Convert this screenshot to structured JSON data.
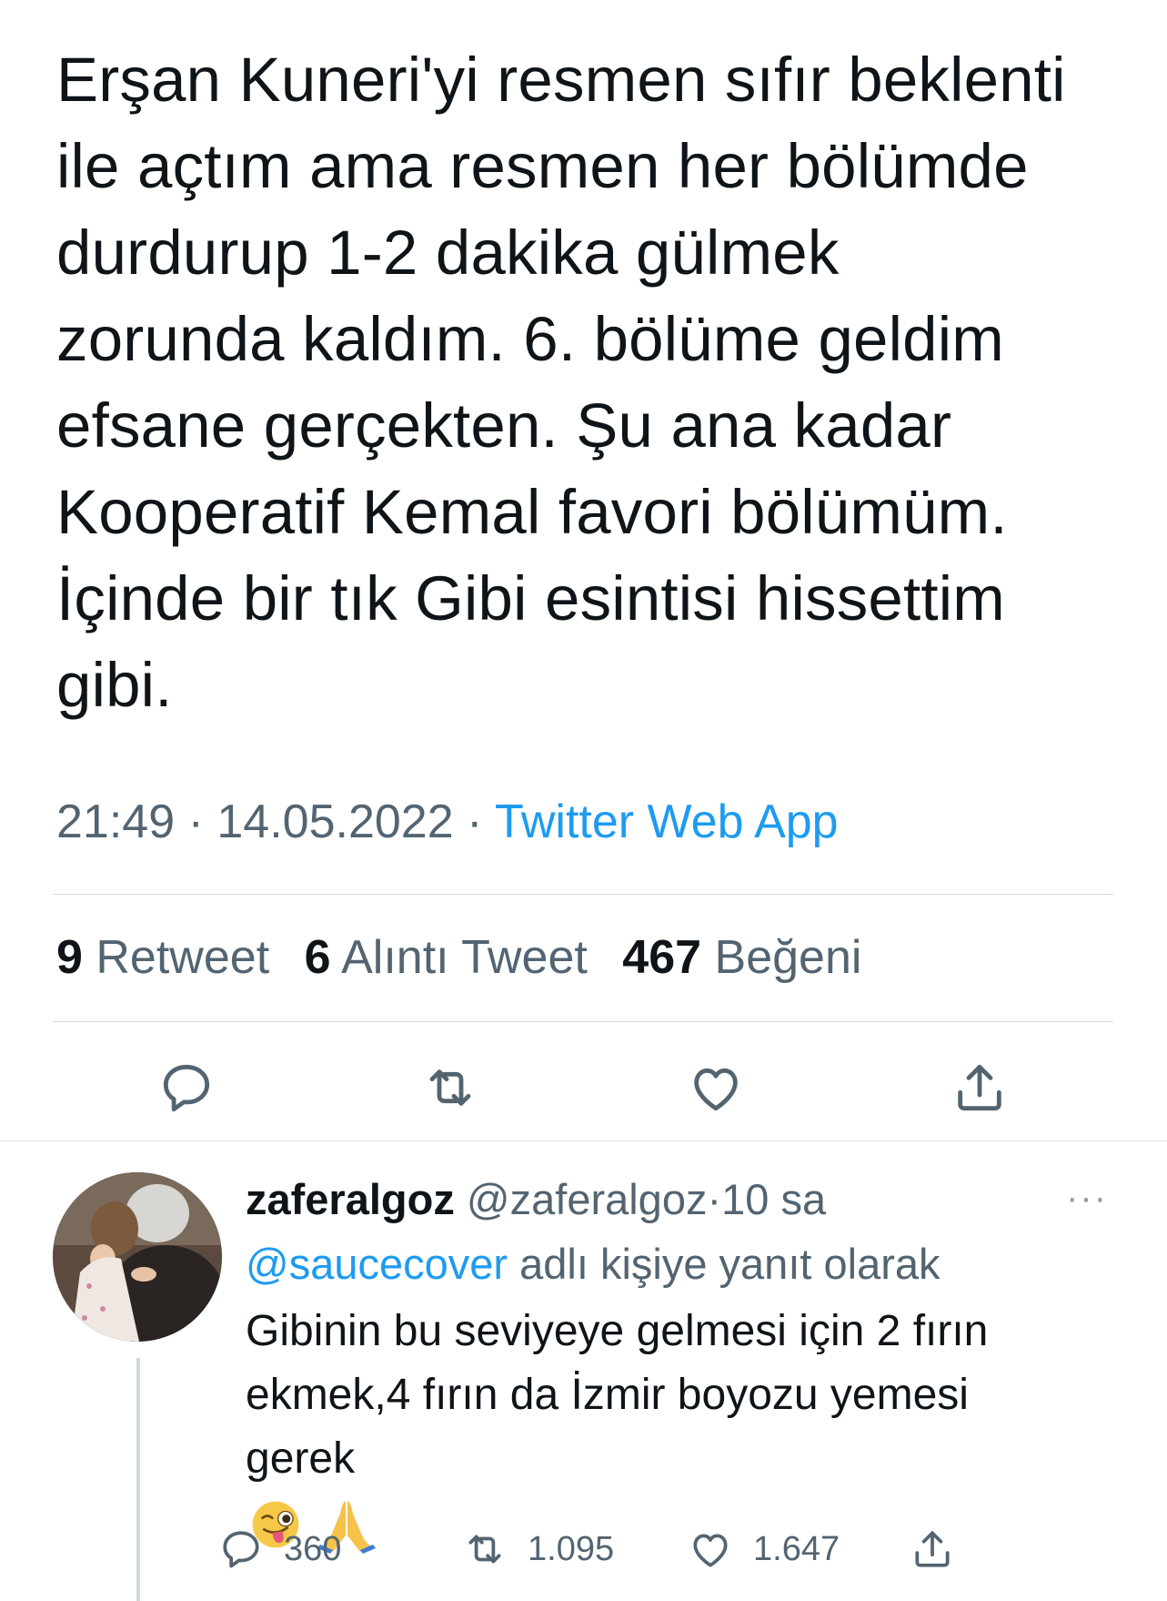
{
  "tweet": {
    "lines": [
      "Erşan Kuneri'yi resmen sıfır beklenti",
      "ile açtım ama resmen her bölümde",
      "durdurup 1-2 dakika gülmek",
      "zorunda kaldım. 6. bölüme geldim",
      "efsane gerçekten. Şu ana kadar",
      "Kooperatif Kemal favori bölümüm.",
      "İçinde bir tık Gibi esintisi hissettim",
      "gibi."
    ],
    "time": "21:49",
    "date": "14.05.2022",
    "source": "Twitter Web App",
    "separator": "·"
  },
  "stats": {
    "retweet_count": "9",
    "retweet_label": "Retweet",
    "quote_count": "6",
    "quote_label": "Alıntı Tweet",
    "like_count": "467",
    "like_label": "Beğeni"
  },
  "actions": {
    "icons": [
      "reply-icon",
      "retweet-icon",
      "like-icon",
      "share-icon"
    ]
  },
  "reply": {
    "name": "zaferalgoz",
    "handle": "@zaferalgoz",
    "separator": "·",
    "time_ago": "10 sa",
    "more": "···",
    "reply_to_handle": "@saucecover",
    "reply_to_suffix": "adlı kişiye yanıt olarak",
    "text_lines": [
      "Gibinin bu seviyeye gelmesi için 2 fırın",
      "ekmek,4 fırın da İzmir boyozu yemesi",
      "gerek"
    ],
    "emojis": [
      "winking-face-with-tongue-icon",
      "folded-hands-icon"
    ],
    "reply_count": "360",
    "retweet_count": "1.095",
    "like_count": "1.647"
  },
  "colors": {
    "text": "#0f1419",
    "secondary": "#536471",
    "link": "#1d9bf0",
    "divider": "#d5dbe0"
  }
}
